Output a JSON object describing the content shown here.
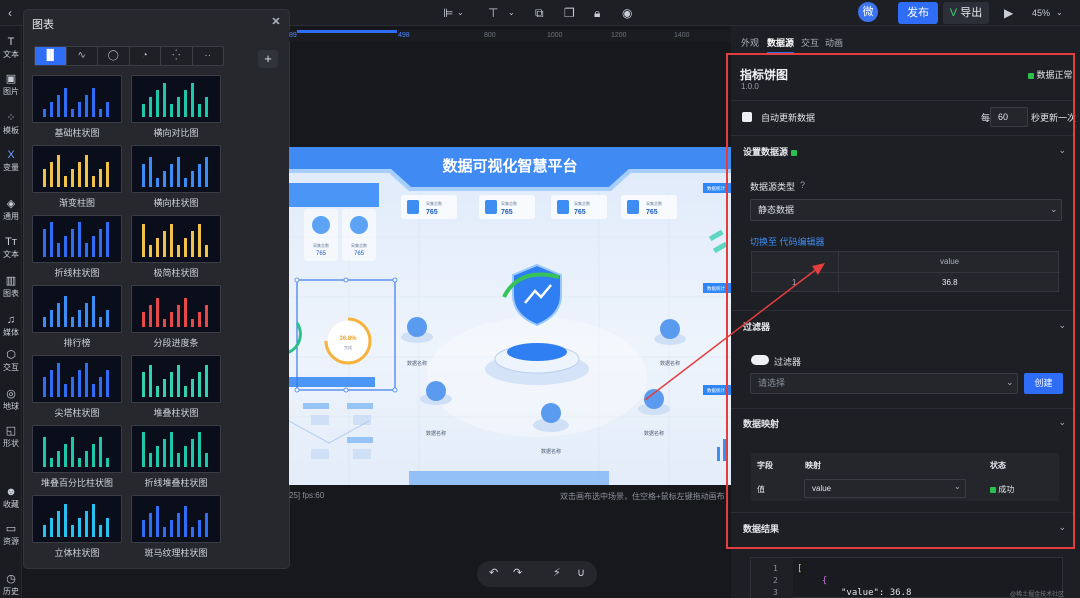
{
  "topbar": {
    "avatar_text": "微",
    "publish_label": "发布",
    "export_label": "导出",
    "zoom": "45%"
  },
  "left_rail": [
    {
      "icon": "T",
      "label": "文本"
    },
    {
      "icon": "▣",
      "label": "图片"
    },
    {
      "icon": "⁘",
      "label": "模板"
    },
    {
      "icon": "X",
      "label": "变量"
    },
    {
      "icon": "◈",
      "label": "通用"
    },
    {
      "icon": "Tт",
      "label": "文本"
    },
    {
      "icon": "▥",
      "label": "图表"
    },
    {
      "icon": "♫",
      "label": "媒体"
    },
    {
      "icon": "⬡",
      "label": "交互"
    },
    {
      "icon": "◎",
      "label": "地球"
    },
    {
      "icon": "◱",
      "label": "形状"
    },
    {
      "icon": "☻",
      "label": "收藏"
    },
    {
      "icon": "▭",
      "label": "资源"
    },
    {
      "icon": "◷",
      "label": "历史"
    }
  ],
  "chart_panel": {
    "title": "图表",
    "type_tabs": [
      "▐▌",
      "∿",
      "◯",
      "◔",
      "⁛",
      "··"
    ],
    "items": [
      {
        "label": "基础柱状图"
      },
      {
        "label": "横向对比图"
      },
      {
        "label": "渐变柱图"
      },
      {
        "label": "横向柱状图"
      },
      {
        "label": "折线柱状图"
      },
      {
        "label": "极简柱状图"
      },
      {
        "label": "排行榜"
      },
      {
        "label": "分段进度条"
      },
      {
        "label": "尖塔柱状图"
      },
      {
        "label": "堆叠柱状图"
      },
      {
        "label": "堆叠百分比柱状图"
      },
      {
        "label": "折线堆叠柱状图"
      },
      {
        "label": "立体柱状图"
      },
      {
        "label": "斑马纹理柱状图"
      }
    ]
  },
  "ruler_ticks": [
    "89",
    "498",
    "800",
    "1000",
    "1200",
    "1400"
  ],
  "canvas": {
    "title": "数据可视化智慧平台",
    "stat_label": "采集总数",
    "stat_value": "765",
    "gauge_value": "36.8%",
    "gauge_caption": "完成",
    "node_label": "数据名称",
    "side_header": "数据统计"
  },
  "status": {
    "coords": "25] fps:60",
    "hint": "双击画布选中场景，住空格+鼠标左键拖动画布"
  },
  "right_panel": {
    "tabs": [
      "外观",
      "数据源",
      "交互",
      "动画"
    ],
    "component_name": "指标饼图",
    "version": "1.0.0",
    "data_status": "数据正常",
    "auto_update_label": "自动更新数据",
    "every_label": "每",
    "interval_value": "60",
    "interval_suffix": "秒更新一次",
    "source_section": "设置数据源",
    "source_type_label": "数据源类型",
    "help_mark": "?",
    "source_type_value": "静态数据",
    "switch_editor_link": "切换至 代码编辑器",
    "table": {
      "header": "value",
      "row_index": "1",
      "row_value": "36.8"
    },
    "filter_section": "过滤器",
    "filter_toggle_label": "过滤器",
    "filter_placeholder": "请选择",
    "create_label": "创建",
    "mapping_section": "数据映射",
    "mapping_headers": [
      "字段",
      "映射",
      "状态"
    ],
    "mapping_row": {
      "field": "值",
      "map": "value",
      "status": "成功"
    },
    "result_section": "数据结果",
    "code_lines": [
      {
        "n": "1",
        "text": "["
      },
      {
        "n": "2",
        "text": "  {"
      },
      {
        "n": "3",
        "text": "\"value\": 36.8"
      }
    ]
  },
  "watermark": "@稀土掘金技术社区"
}
